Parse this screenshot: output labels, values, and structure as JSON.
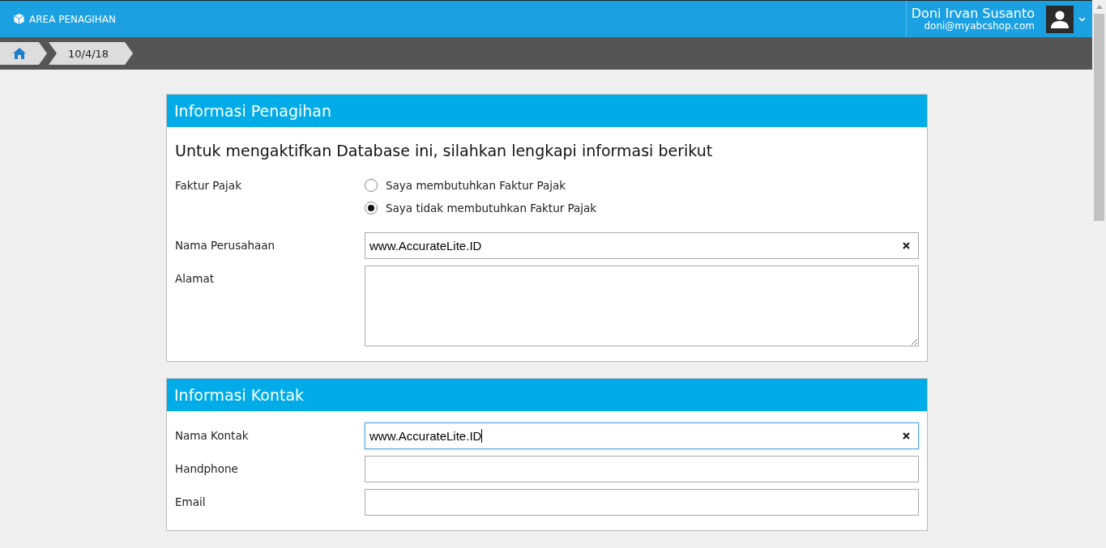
{
  "header": {
    "title": "AREA PENAGIHAN",
    "user_name": "Doni Irvan Susanto",
    "user_email": "doni@myabcshop.com"
  },
  "breadcrumb": [
    "10/4/18"
  ],
  "sections": [
    {
      "title": "Informasi Penagihan",
      "intro": "Untuk mengaktifkan Database ini, silahkan lengkapi informasi berikut",
      "fields": [
        {
          "kind": "radio",
          "label": "Faktur Pajak",
          "options": [
            {
              "label": "Saya membutuhkan Faktur Pajak",
              "selected": false
            },
            {
              "label": "Saya tidak membutuhkan Faktur Pajak",
              "selected": true
            }
          ]
        },
        {
          "kind": "text",
          "label": "Nama Perusahaan",
          "value": "www.AccurateLite.ID",
          "focused": false
        },
        {
          "kind": "textarea",
          "label": "Alamat",
          "focused": false
        }
      ]
    },
    {
      "title": "Informasi Kontak",
      "fields": [
        {
          "kind": "text",
          "label": "Nama Kontak",
          "value": "www.AccurateLite.ID",
          "focused": true
        },
        {
          "kind": "text",
          "label": "Handphone",
          "focused": false
        },
        {
          "kind": "text",
          "label": "Email",
          "focused": false
        }
      ]
    }
  ]
}
